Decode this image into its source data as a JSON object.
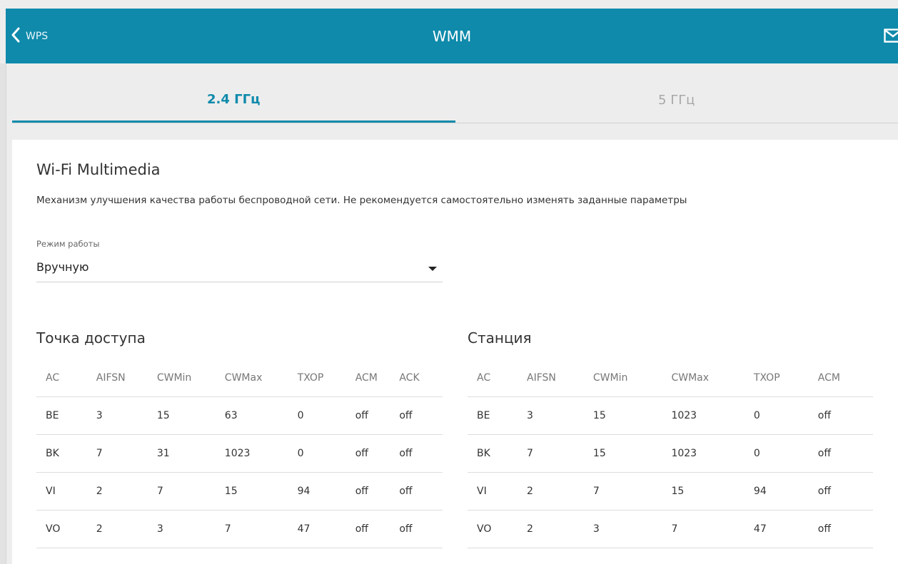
{
  "header": {
    "back_label": "WPS",
    "title": "WMM"
  },
  "tabs": [
    {
      "label": "2.4 ГГц",
      "active": true
    },
    {
      "label": "5 ГГц",
      "active": false
    }
  ],
  "card": {
    "title": "Wi-Fi Multimedia",
    "description": "Механизм улучшения качества работы беспроводной сети. Не рекомендуется самостоятельно изменять заданные параметры",
    "mode_label": "Режим работы",
    "mode_value": "Вручную"
  },
  "access_point": {
    "title": "Точка доступа",
    "columns": [
      "AC",
      "AIFSN",
      "CWMin",
      "CWMax",
      "TXOP",
      "ACM",
      "ACK"
    ],
    "rows": [
      [
        "BE",
        "3",
        "15",
        "63",
        "0",
        "off",
        "off"
      ],
      [
        "BK",
        "7",
        "31",
        "1023",
        "0",
        "off",
        "off"
      ],
      [
        "VI",
        "2",
        "7",
        "15",
        "94",
        "off",
        "off"
      ],
      [
        "VO",
        "2",
        "3",
        "7",
        "47",
        "off",
        "off"
      ]
    ]
  },
  "station": {
    "title": "Станция",
    "columns": [
      "AC",
      "AIFSN",
      "CWMin",
      "CWMax",
      "TXOP",
      "ACM"
    ],
    "rows": [
      [
        "BE",
        "3",
        "15",
        "1023",
        "0",
        "off"
      ],
      [
        "BK",
        "7",
        "15",
        "1023",
        "0",
        "off"
      ],
      [
        "VI",
        "2",
        "7",
        "15",
        "94",
        "off"
      ],
      [
        "VO",
        "2",
        "3",
        "7",
        "47",
        "off"
      ]
    ]
  },
  "colors": {
    "accent": "#0f8aab",
    "background": "#ededed",
    "card": "#ffffff"
  }
}
